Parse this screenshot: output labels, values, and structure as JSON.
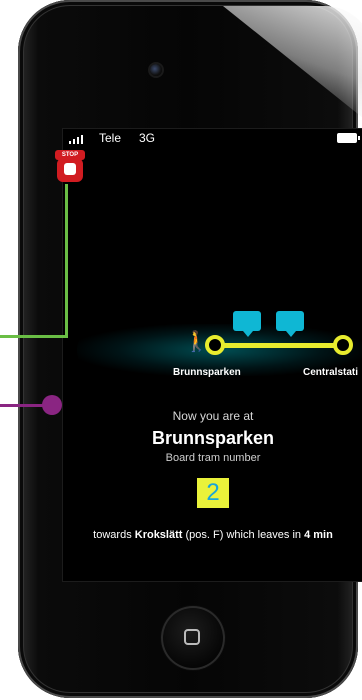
{
  "status_bar": {
    "carrier": "Tele",
    "network": "3G"
  },
  "route": {
    "from_stop": "Brunnsparken",
    "to_stop": "Centralstati"
  },
  "info": {
    "now_label": "Now you are at",
    "station": "Brunnsparken",
    "board_label": "Board tram number",
    "tram_number": "2",
    "towards_prefix": "towards ",
    "towards_destination": "Krokslätt",
    "towards_middle": " (pos. F) which leaves in ",
    "towards_time": "4 min"
  },
  "annotation": {
    "stop_sign_text": "STOP"
  },
  "colors": {
    "route_yellow": "#e8ec2e",
    "bubble_cyan": "#0fb7d4",
    "annotation_green": "#6abe45",
    "annotation_purple": "#8a2582",
    "stop_red": "#d11c21"
  },
  "icons": [
    "walking-person-icon",
    "speech-bubble-icon",
    "stop-sign-icon",
    "home-button-icon",
    "signal-icon",
    "battery-icon"
  ]
}
